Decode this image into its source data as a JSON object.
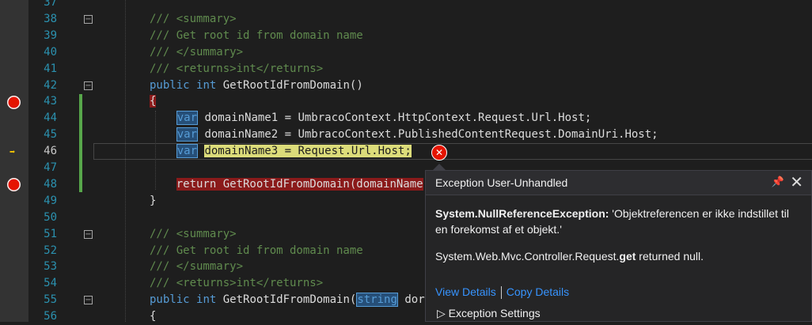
{
  "editor": {
    "lines": [
      {
        "num": "37",
        "html": ""
      },
      {
        "num": "38",
        "html": "<span class=\"cmt\">/// &lt;summary&gt;</span>"
      },
      {
        "num": "39",
        "html": "<span class=\"cmt\">/// Get root id from domain name</span>"
      },
      {
        "num": "40",
        "html": "<span class=\"cmt\">/// &lt;/summary&gt;</span>"
      },
      {
        "num": "41",
        "html": "<span class=\"cmt\">/// &lt;returns&gt;int&lt;/returns&gt;</span>"
      },
      {
        "num": "42",
        "html": "<span class=\"kw\">public</span> <span class=\"kw\">int</span> GetRootIdFromDomain()"
      },
      {
        "num": "43",
        "html": "<span class=\"redbg\">{</span>"
      },
      {
        "num": "44",
        "html": "    <span class=\"var\">var</span> domainName1 = UmbracoContext.HttpContext.Request.Url.Host;"
      },
      {
        "num": "45",
        "html": "    <span class=\"var\">var</span> domainName2 = UmbracoContext.PublishedContentRequest.DomainUri.Host;"
      },
      {
        "num": "46",
        "html": "    <span class=\"var\">var</span> <span class=\"yel\">domainName3 = Request.Url.Host;</span>"
      },
      {
        "num": "47",
        "html": ""
      },
      {
        "num": "48",
        "html": "    <span class=\"redbg\">return GetRootIdFromDomain(domainName</span>"
      },
      {
        "num": "49",
        "html": "}"
      },
      {
        "num": "50",
        "html": ""
      },
      {
        "num": "51",
        "html": "<span class=\"cmt\">/// &lt;summary&gt;</span>"
      },
      {
        "num": "52",
        "html": "<span class=\"cmt\">/// Get root id from domain name</span>"
      },
      {
        "num": "53",
        "html": "<span class=\"cmt\">/// &lt;/summary&gt;</span>"
      },
      {
        "num": "54",
        "html": "<span class=\"cmt\">/// &lt;returns&gt;int&lt;/returns&gt;</span>"
      },
      {
        "num": "55",
        "html": "<span class=\"kw\">public</span> <span class=\"kw\">int</span> GetRootIdFromDomain(<span class=\"var\">string</span> dor"
      },
      {
        "num": "56",
        "html": "{"
      }
    ]
  },
  "popup": {
    "title": "Exception User-Unhandled",
    "pin_icon": "📌",
    "close_icon": "✕",
    "exception_type": "System.NullReferenceException:",
    "exception_message": " 'Objektreferencen er ikke indstillet til en forekomst af et objekt.'",
    "detail_prefix": "System.Web.Mvc.Controller.Request.",
    "detail_bold": "get",
    "detail_suffix": " returned null.",
    "view_details": "View Details",
    "copy_details": "Copy Details",
    "settings": "Exception Settings",
    "settings_chevron": "▷"
  }
}
